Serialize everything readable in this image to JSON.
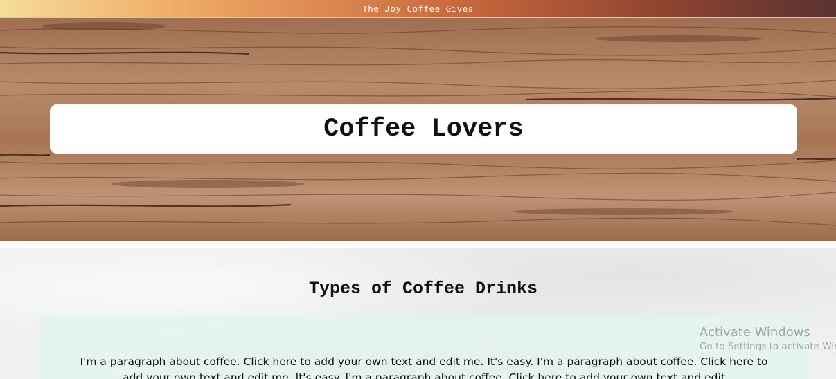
{
  "banner": {
    "text": "The Joy Coffee Gives"
  },
  "hero": {
    "title": "Coffee Lovers"
  },
  "section": {
    "title": "Types of Coffee Drinks",
    "paragraph": "I'm a paragraph about coffee. Click here to add your own text and edit me. It's easy. I'm a paragraph about coffee. Click here to add your own text and edit me. It's easy. I'm a paragraph about coffee. Click here to add your own text and edit"
  },
  "watermark": {
    "line1": "Activate Windows",
    "line2": "Go to Settings to activate Windows."
  },
  "colors": {
    "banner_gradient_start": "#f6dc9a",
    "banner_gradient_end": "#5a3230",
    "wood": "#a87858",
    "panel": "#e2f4ec"
  }
}
